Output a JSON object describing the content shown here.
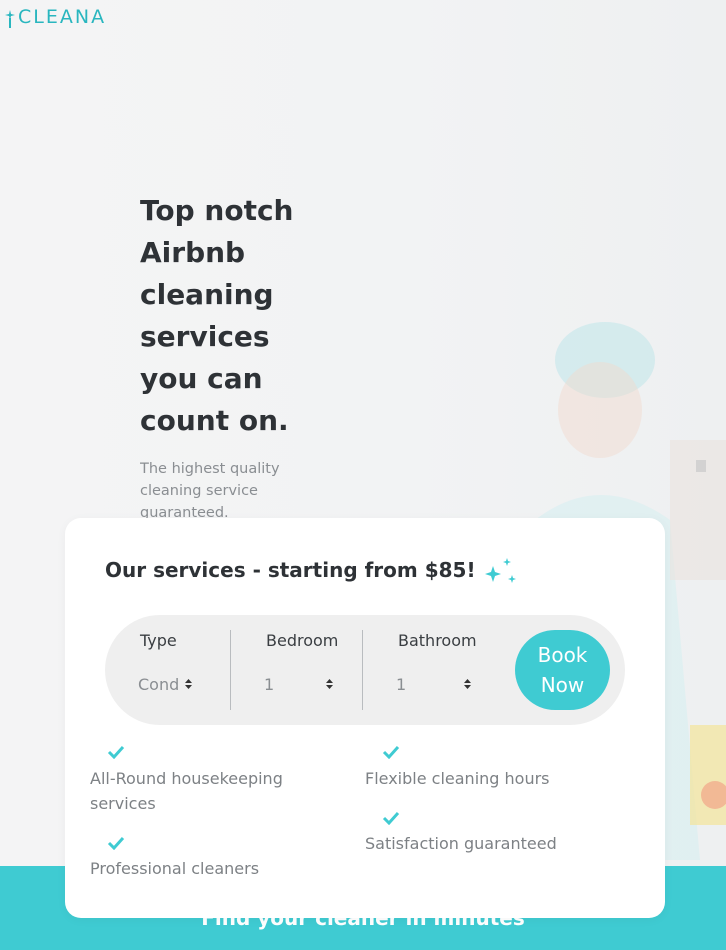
{
  "brand": {
    "name": "CLEANA",
    "accent_color": "#3fcbd2",
    "logo_icon": "sparkle-icon"
  },
  "hero": {
    "headline": "Top notch Airbnb cleaning services you can count on.",
    "subline": "The highest quality cleaning service guaranteed."
  },
  "booking_card": {
    "title": "Our services - starting from $85!",
    "title_icon": "sparkles-icon",
    "fields": [
      {
        "label": "Type",
        "value": "Cond"
      },
      {
        "label": "Bedroom",
        "value": "1"
      },
      {
        "label": "Bathroom",
        "value": "1"
      }
    ],
    "book_button": "Book Now",
    "features": [
      "All-Round housekeeping services",
      "Flexible cleaning hours",
      "Professional cleaners",
      "Satisfaction guaranteed"
    ],
    "feature_icon": "check-icon"
  },
  "footer_band": {
    "text": "Find your cleaner in minutes"
  }
}
